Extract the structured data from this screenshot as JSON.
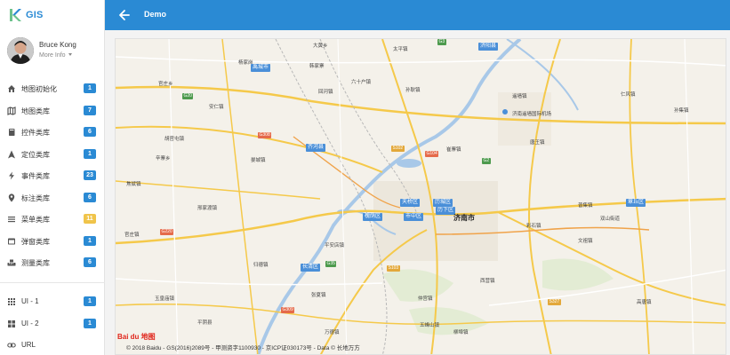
{
  "brand": {
    "name": "GIS",
    "logo_letter": "K"
  },
  "user": {
    "name": "Bruce Kong",
    "more_label": "More Info"
  },
  "menu": [
    {
      "label": "地图初始化",
      "badge": "1",
      "badge_color": "#2a8ad4",
      "icon": "home-icon"
    },
    {
      "label": "地图类库",
      "badge": "7",
      "badge_color": "#2a8ad4",
      "icon": "map-icon"
    },
    {
      "label": "控件类库",
      "badge": "6",
      "badge_color": "#2a8ad4",
      "icon": "book-icon"
    },
    {
      "label": "定位类库",
      "badge": "1",
      "badge_color": "#2a8ad4",
      "icon": "navigation-icon"
    },
    {
      "label": "事件类库",
      "badge": "23",
      "badge_color": "#2a8ad4",
      "icon": "lightning-icon"
    },
    {
      "label": "标注类库",
      "badge": "6",
      "badge_color": "#2a8ad4",
      "icon": "pin-icon"
    },
    {
      "label": "菜单类库",
      "badge": "11",
      "badge_color": "#f0c44a",
      "icon": "menu-lines-icon"
    },
    {
      "label": "弹窗类库",
      "badge": "1",
      "badge_color": "#2a8ad4",
      "icon": "window-icon"
    },
    {
      "label": "测量类库",
      "badge": "6",
      "badge_color": "#2a8ad4",
      "icon": "ruler-icon"
    }
  ],
  "menu2": [
    {
      "label": "UI - 1",
      "badge": "1",
      "badge_color": "#2a8ad4",
      "icon": "grid-icon"
    },
    {
      "label": "UI - 2",
      "badge": "1",
      "badge_color": "#2a8ad4",
      "icon": "apps-icon"
    },
    {
      "label": "URL",
      "badge": "",
      "badge_color": "",
      "icon": "link-icon"
    }
  ],
  "header": {
    "title": "Demo",
    "accent": "#2a8ad4"
  },
  "map": {
    "city": "济南市",
    "districts": [
      "禹城市",
      "济阳县",
      "齐河县",
      "天桥区",
      "历城区",
      "历下区",
      "槐荫区",
      "市中区",
      "长清区",
      "章丘区"
    ],
    "places": [
      "大黄乡",
      "太平镇",
      "杨家岗",
      "韩家寨",
      "官庄乡",
      "六十户镇",
      "安仁镇",
      "回河镇",
      "孙耿镇",
      "遥墙镇",
      "济南遥墙国际机场",
      "仁风镇",
      "唐王镇",
      "孙集镇",
      "晏城镇",
      "胡官屯镇",
      "焦斌镇",
      "崔寨镇",
      "邢家渡镇",
      "张夏镇",
      "万德镇",
      "五峰山镇",
      "平安店镇",
      "归德镇",
      "文祖镇",
      "西营镇",
      "柳埠镇",
      "仲宫镇",
      "彩石镇",
      "普集镇",
      "官庄镇",
      "高唐镇",
      "玉皇庙镇",
      "平阴县",
      "双山街道",
      "辛寨乡"
    ],
    "highways": [
      "G3",
      "G20",
      "G35",
      "G2",
      "G220",
      "G104",
      "G308",
      "G309",
      "S102",
      "S103",
      "S327"
    ],
    "baidu_logo": "Bai du 地图",
    "copyright": "© 2018 Baidu - GS(2016)2089号 - 甲测资字1100930 - 京ICP证030173号 - Data © 长地万方"
  }
}
